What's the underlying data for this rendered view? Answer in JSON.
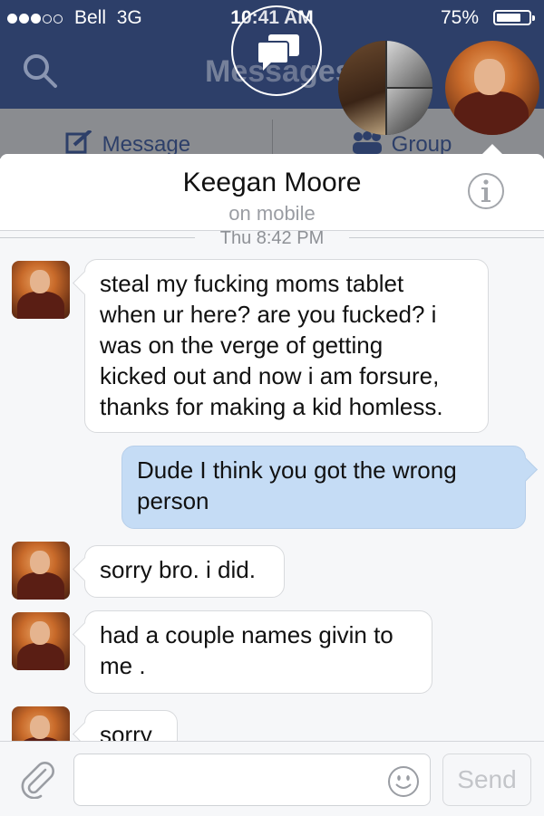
{
  "status_bar": {
    "signal_dots_filled": 3,
    "signal_dots_total": 5,
    "carrier": "Bell",
    "network": "3G",
    "time": "10:41 AM",
    "battery_percent": "75%",
    "battery_level": 0.75
  },
  "nav": {
    "title": "Messages",
    "icons": [
      "search-icon",
      "chat-bubbles-icon"
    ]
  },
  "chat_heads": [
    {
      "type": "group"
    },
    {
      "type": "single",
      "active": true
    }
  ],
  "sub_toolbar": {
    "message_label": "Message",
    "group_label": "Group"
  },
  "conversation": {
    "contact_name": "Keegan Moore",
    "status": "on mobile",
    "timestamp": "Thu 8:42 PM"
  },
  "messages": [
    {
      "direction": "in",
      "lines": [
        "steal my fucking moms tablet",
        "when ur here? are you fucked? i",
        "was on the verge of getting",
        "kicked out and now i am forsure,",
        "thanks for making a kid homless."
      ]
    },
    {
      "direction": "out",
      "lines": [
        "Dude I think you got the wrong",
        "person"
      ]
    },
    {
      "direction": "in",
      "lines": [
        "sorry bro. i did."
      ]
    },
    {
      "direction": "in",
      "lines": [
        "had a couple names givin to",
        "me ."
      ]
    },
    {
      "direction": "in",
      "lines": [
        "sorry"
      ]
    }
  ],
  "composer": {
    "placeholder": "",
    "send_label": "Send"
  },
  "colors": {
    "header_bg": "#2d3f69",
    "outgoing_bubble": "#c5dcf5",
    "incoming_bubble": "#ffffff"
  }
}
